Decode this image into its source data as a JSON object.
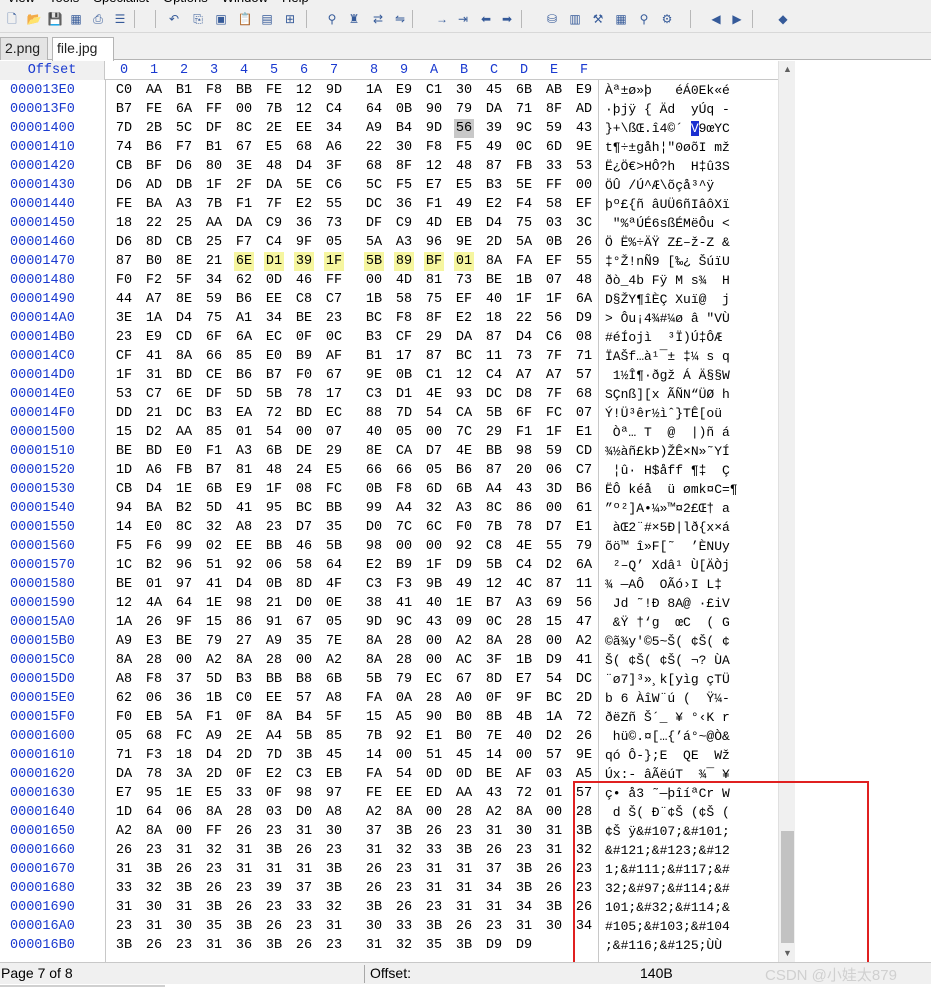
{
  "menu": [
    "View",
    "Tools",
    "Specialist",
    "Options",
    "Window",
    "Help"
  ],
  "toolbar_icons": [
    "new-file-icon",
    "open-file-icon",
    "save-icon",
    "save-all-icon",
    "print-icon",
    "properties-icon",
    "undo-icon",
    "copy-icon",
    "copy-block-icon",
    "paste-icon",
    "paste-write-icon",
    "copy-hex-icon",
    "find-icon",
    "find-hex-icon",
    "replace-icon",
    "replace-hex-icon",
    "goto-icon",
    "goto-offset-icon",
    "back-icon",
    "forward-icon",
    "disk-icon",
    "ram-icon",
    "tools-icon",
    "calculator-icon",
    "search-file-icon",
    "gear-icon",
    "previous-icon",
    "next-icon",
    "book-icon"
  ],
  "tabs": [
    "2.png",
    "file.jpg"
  ],
  "active_tab": 1,
  "header": {
    "offset_label": "Offset",
    "columns": [
      "0",
      "1",
      "2",
      "3",
      "4",
      "5",
      "6",
      "7",
      "8",
      "9",
      "A",
      "B",
      "C",
      "D",
      "E",
      "F"
    ]
  },
  "rows": [
    {
      "off": "000013E0",
      "hex": "C0 AA B1 F8 BB FE 12 9D 1A E9 C1 30 45 6B AB E9",
      "txt": "Àª±ø»þ   éÁ0Ek«é"
    },
    {
      "off": "000013F0",
      "hex": "B7 FE 6A FF 00 7B 12 C4 64 0B 90 79 DA 71 8F AD",
      "txt": "·þjÿ { Äd  yÚq -"
    },
    {
      "off": "00001400",
      "hex": "7D 2B 5C DF 8C 2E EE 34 A9 B4 9D 56 39 9C 59 43",
      "txt": "}+\\ßŒ.î4©´ V9œYC"
    },
    {
      "off": "00001410",
      "hex": "74 B6 F7 B1 67 E5 68 A6 22 30 F8 F5 49 0C 6D 9E",
      "txt": "t¶÷±gåh¦\"0øõI mž"
    },
    {
      "off": "00001420",
      "hex": "CB BF D6 80 3E 48 D4 3F 68 8F 12 48 87 FB 33 53",
      "txt": "Ë¿Ö€>HÔ?h  H‡û3S"
    },
    {
      "off": "00001430",
      "hex": "D6 AD DB 1F 2F DA 5E C6 5C F5 E7 E5 B3 5E FF 00",
      "txt": "Ö­Û /Ú^Æ\\õçå³^ÿ "
    },
    {
      "off": "00001440",
      "hex": "FE BA A3 7B F1 7F E2 55 DC 36 F1 49 E2 F4 58 EF",
      "txt": "þº£{ñ âUÜ6ñIâôXï"
    },
    {
      "off": "00001450",
      "hex": "18 22 25 AA DA C9 36 73 DF C9 4D EB D4 75 03 3C",
      "txt": " \"%ªÚÉ6sßÉMëÔu <"
    },
    {
      "off": "00001460",
      "hex": "D6 8D CB 25 F7 C4 9F 05 5A A3 96 9E 2D 5A 0B 26",
      "txt": "Ö Ë%÷ÄŸ Z£–ž-Z &"
    },
    {
      "off": "00001470",
      "hex": "87 B0 8E 21 6E D1 39 1F 5B 89 BF 01 8A FA EF 55",
      "txt": "‡°Ž!nÑ9 [‰¿ ŠúïU"
    },
    {
      "off": "00001480",
      "hex": "F0 F2 5F 34 62 0D 46 FF 00 4D 81 73 BE 1B 07 48",
      "txt": "ðò_4b Fÿ M s¾  H"
    },
    {
      "off": "00001490",
      "hex": "44 A7 8E 59 B6 EE C8 C7 1B 58 75 EF 40 1F 1F 6A",
      "txt": "D§ŽY¶îÈÇ Xuï@  j"
    },
    {
      "off": "000014A0",
      "hex": "3E 1A D4 75 A1 34 BE 23 BC F8 8F E2 18 22 56 D9",
      "txt": "> Ôu¡4¾#¼ø â \"VÙ"
    },
    {
      "off": "000014B0",
      "hex": "23 E9 CD 6F 6A EC 0F 0C B3 CF 29 DA 87 D4 C6 08",
      "txt": "#éÍojì  ³Ï)Ú‡ÔÆ "
    },
    {
      "off": "000014C0",
      "hex": "CF 41 8A 66 85 E0 B9 AF B1 17 87 BC 11 73 7F 71",
      "txt": "ÏAŠf…à¹¯± ‡¼ s q"
    },
    {
      "off": "000014D0",
      "hex": "1F 31 BD CE B6 B7 F0 67 9E 0B C1 12 C4 A7 A7 57",
      "txt": " 1½Î¶·ðgž Á Ä§§W"
    },
    {
      "off": "000014E0",
      "hex": "53 C7 6E DF 5D 5B 78 17 C3 D1 4E 93 DC D8 7F 68",
      "txt": "SÇnß][x ÃÑN“ÜØ h"
    },
    {
      "off": "000014F0",
      "hex": "DD 21 DC B3 EA 72 BD EC 88 7D 54 CA 5B 6F FC 07",
      "txt": "Ý!Ü³êr½ìˆ}TÊ[oü "
    },
    {
      "off": "00001500",
      "hex": "15 D2 AA 85 01 54 00 07 40 05 00 7C 29 F1 1F E1",
      "txt": " Òª… T  @  |)ñ á"
    },
    {
      "off": "00001510",
      "hex": "BE BD E0 F1 A3 6B DE 29 8E CA D7 4E BB 98 59 CD",
      "txt": "¾½àñ£kÞ)ŽÊ×N»˜YÍ"
    },
    {
      "off": "00001520",
      "hex": "1D A6 FB B7 81 48 24 E5 66 66 05 B6 87 20 06 C7",
      "txt": " ¦û· H$åff ¶‡  Ç"
    },
    {
      "off": "00001530",
      "hex": "CB D4 1E 6B E9 1F 08 FC 0B F8 6D 6B A4 43 3D B6",
      "txt": "ËÔ kéå  ü ømk¤C=¶"
    },
    {
      "off": "00001540",
      "hex": "94 BA B2 5D 41 95 BC BB 99 A4 32 A3 8C 86 00 61",
      "txt": "”º²]A•¼»™¤2£Œ† a"
    },
    {
      "off": "00001550",
      "hex": "14 E0 8C 32 A8 23 D7 35 D0 7C 6C F0 7B 78 D7 E1",
      "txt": " àŒ2¨#×5Ð|lð{x×á"
    },
    {
      "off": "00001560",
      "hex": "F5 F6 99 02 EE BB 46 5B 98 00 00 92 C8 4E 55 79",
      "txt": "õö™ î»F[˜  ’ÈNUy"
    },
    {
      "off": "00001570",
      "hex": "1C B2 96 51 92 06 58 64 E2 B9 1F D9 5B C4 D2 6A",
      "txt": " ²–Q’ Xdâ¹ Ù[ÄÒj"
    },
    {
      "off": "00001580",
      "hex": "BE 01 97 41 D4 0B 8D 4F C3 F3 9B 49 12 4C 87 11",
      "txt": "¾ —AÔ  OÃó›I L‡ "
    },
    {
      "off": "00001590",
      "hex": "12 4A 64 1E 98 21 D0 0E 38 41 40 1E B7 A3 69 56",
      "txt": " Jd ˜!Ð 8A@ ·£iV"
    },
    {
      "off": "000015A0",
      "hex": "1A 26 9F 15 86 91 67 05 9D 9C 43 09 0C 28 15 47",
      "txt": " &Ÿ †‘g  œC  ( G"
    },
    {
      "off": "000015B0",
      "hex": "A9 E3 BE 79 27 A9 35 7E 8A 28 00 A2 8A 28 00 A2",
      "txt": "©ã¾y'©5~Š( ¢Š( ¢"
    },
    {
      "off": "000015C0",
      "hex": "8A 28 00 A2 8A 28 00 A2 8A 28 00 AC 3F 1B D9 41",
      "txt": "Š( ¢Š( ¢Š( ¬? ÙA"
    },
    {
      "off": "000015D0",
      "hex": "A8 F8 37 5D B3 BB B8 6B 5B 79 EC 67 8D E7 54 DC",
      "txt": "¨ø7]³»¸k[yìg çTÜ"
    },
    {
      "off": "000015E0",
      "hex": "62 06 36 1B C0 EE 57 A8 FA 0A 28 A0 0F 9F BC 2D",
      "txt": "b 6 ÀîW¨ú (  Ÿ¼-"
    },
    {
      "off": "000015F0",
      "hex": "F0 EB 5A F1 0F 8A B4 5F 15 A5 90 B0 8B 4B 1A 72",
      "txt": "ðëZñ Š´_ ¥ °‹K r"
    },
    {
      "off": "00001600",
      "hex": "05 68 FC A9 2E A4 5B 85 7B 92 E1 B0 7E 40 D2 26",
      "txt": " hü©.¤[…{’á°~@Ò&"
    },
    {
      "off": "00001610",
      "hex": "71 F3 18 D4 2D 7D 3B 45 14 00 51 45 14 00 57 9E",
      "txt": "qó Ô-};E  QE  Wž"
    },
    {
      "off": "00001620",
      "hex": "DA 78 3A 2D 0F E2 C3 EB FA 54 0D 0D BE AF 03 A5",
      "txt": "Úx:- âÃëúT  ¾¯ ¥"
    },
    {
      "off": "00001630",
      "hex": "E7 95 1E E5 33 0F 98 97 FE EE ED AA 43 72 01 57",
      "txt": "ç• å3 ˜—þîíªCr W"
    },
    {
      "off": "00001640",
      "hex": "1D 64 06 8A 28 03 D0 A8 A2 8A 00 28 A2 8A 00 28",
      "txt": " d Š( Ð¨¢Š (¢Š ("
    },
    {
      "off": "00001650",
      "hex": "A2 8A 00 FF 26 23 31 30 37 3B 26 23 31 30 31 3B",
      "txt": "¢Š ÿ&#107;&#101;"
    },
    {
      "off": "00001660",
      "hex": "26 23 31 32 31 3B 26 23 31 32 33 3B 26 23 31 32",
      "txt": "&#121;&#123;&#12"
    },
    {
      "off": "00001670",
      "hex": "31 3B 26 23 31 31 31 3B 26 23 31 31 37 3B 26 23",
      "txt": "1;&#111;&#117;&#"
    },
    {
      "off": "00001680",
      "hex": "33 32 3B 26 23 39 37 3B 26 23 31 31 34 3B 26 23",
      "txt": "32;&#97;&#114;&#"
    },
    {
      "off": "00001690",
      "hex": "31 30 31 3B 26 23 33 32 3B 26 23 31 31 34 3B 26",
      "txt": "101;&#32;&#114;&"
    },
    {
      "off": "000016A0",
      "hex": "23 31 30 35 3B 26 23 31 30 33 3B 26 23 31 30 34",
      "txt": "#105;&#103;&#104"
    },
    {
      "off": "000016B0",
      "hex": "3B 26 23 31 36 3B 26 23 31 32 35 3B D9 D9",
      "txt": ";&#116;&#125;ÙÙ"
    }
  ],
  "cursor": {
    "row": 2,
    "byte": 11,
    "text_char": 11
  },
  "highlight": {
    "row": 9,
    "from": 4,
    "to": 11
  },
  "status": {
    "page": "Page 7 of 8",
    "offset_label": "Offset:",
    "offset_value": "140B"
  },
  "watermark": "CSDN @小娃太879"
}
